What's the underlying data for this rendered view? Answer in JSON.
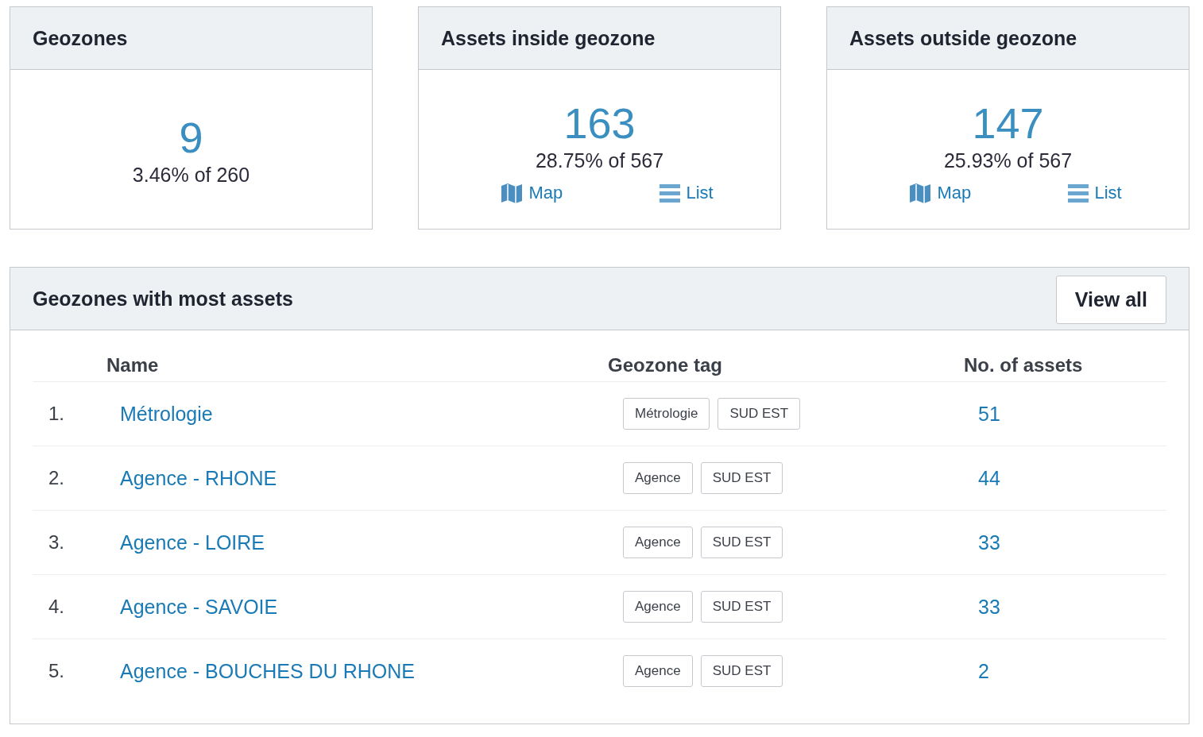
{
  "cards": [
    {
      "title": "Geozones",
      "value": "9",
      "caption": "3.46% of 260"
    },
    {
      "title": "Assets inside geozone",
      "value": "163",
      "caption": "28.75% of 567",
      "links": [
        {
          "kind": "map",
          "label": "Map"
        },
        {
          "kind": "list",
          "label": "List"
        }
      ]
    },
    {
      "title": "Assets outside geozone",
      "value": "147",
      "caption": "25.93% of 567",
      "links": [
        {
          "kind": "map",
          "label": "Map"
        },
        {
          "kind": "list",
          "label": "List"
        }
      ]
    }
  ],
  "panel": {
    "title": "Geozones with most assets",
    "button": "View all",
    "columns": [
      "Name",
      "Geozone tag",
      "No. of assets"
    ],
    "rows": [
      {
        "index": "1.",
        "name": "Métrologie",
        "tags": [
          "Métrologie",
          "SUD EST"
        ],
        "count": "51"
      },
      {
        "index": "2.",
        "name": "Agence - RHONE",
        "tags": [
          "Agence",
          "SUD EST"
        ],
        "count": "44"
      },
      {
        "index": "3.",
        "name": "Agence - LOIRE",
        "tags": [
          "Agence",
          "SUD EST"
        ],
        "count": "33"
      },
      {
        "index": "4.",
        "name": "Agence - SAVOIE",
        "tags": [
          "Agence",
          "SUD EST"
        ],
        "count": "33"
      },
      {
        "index": "5.",
        "name": "Agence - BOUCHES DU RHONE",
        "tags": [
          "Agence",
          "SUD EST"
        ],
        "count": "2"
      }
    ]
  }
}
